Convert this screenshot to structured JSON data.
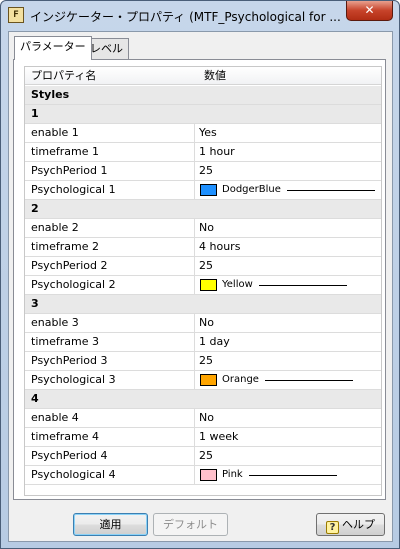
{
  "window": {
    "title": "インジケーター・プロパティ (MTF_Psychological for ...",
    "close_glyph": "✕",
    "icon_text": "F"
  },
  "tabs": [
    {
      "label": "パラメーター",
      "active": true
    },
    {
      "label": "レベル",
      "active": false
    }
  ],
  "grid": {
    "columns": [
      "プロパティ名",
      "数値"
    ],
    "rows": [
      {
        "type": "section",
        "name": "Styles"
      },
      {
        "type": "section",
        "name": "1"
      },
      {
        "type": "value",
        "name": "enable 1",
        "value": "Yes"
      },
      {
        "type": "value",
        "name": "timeframe 1",
        "value": "1 hour"
      },
      {
        "type": "value",
        "name": "PsychPeriod 1",
        "value": "25"
      },
      {
        "type": "color",
        "name": "Psychological 1",
        "value": "DodgerBlue",
        "color": "#1e90ff"
      },
      {
        "type": "section",
        "name": "2"
      },
      {
        "type": "value",
        "name": "enable 2",
        "value": "No"
      },
      {
        "type": "value",
        "name": "timeframe 2",
        "value": "4 hours"
      },
      {
        "type": "value",
        "name": "PsychPeriod 2",
        "value": "25"
      },
      {
        "type": "color",
        "name": "Psychological 2",
        "value": "Yellow",
        "color": "#ffff00"
      },
      {
        "type": "section",
        "name": "3"
      },
      {
        "type": "value",
        "name": "enable 3",
        "value": "No"
      },
      {
        "type": "value",
        "name": "timeframe 3",
        "value": "1 day"
      },
      {
        "type": "value",
        "name": "PsychPeriod 3",
        "value": "25"
      },
      {
        "type": "color",
        "name": "Psychological 3",
        "value": "Orange",
        "color": "#ffa500"
      },
      {
        "type": "section",
        "name": "4"
      },
      {
        "type": "value",
        "name": "enable 4",
        "value": "No"
      },
      {
        "type": "value",
        "name": "timeframe 4",
        "value": "1 week"
      },
      {
        "type": "value",
        "name": "PsychPeriod 4",
        "value": "25"
      },
      {
        "type": "color",
        "name": "Psychological 4",
        "value": "Pink",
        "color": "#ffc0cb"
      }
    ]
  },
  "buttons": {
    "apply": "適用",
    "default": "デフォルト",
    "help": "ヘルプ",
    "help_icon": "?"
  }
}
